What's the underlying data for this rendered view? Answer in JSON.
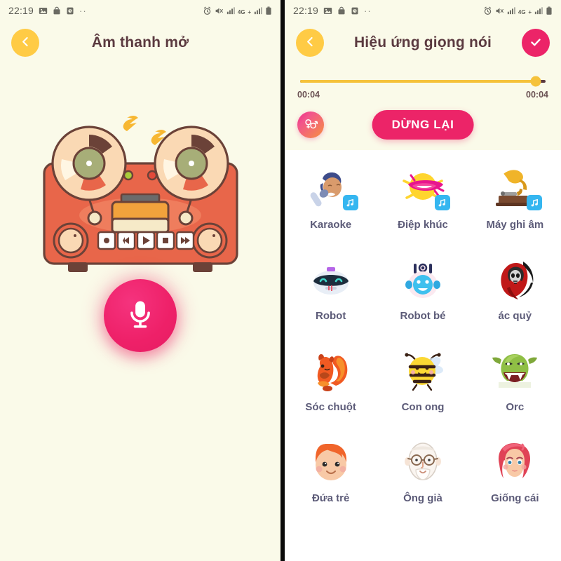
{
  "status_bar": {
    "time": "22:19",
    "left_icons": [
      "gallery-icon",
      "bag-icon",
      "clock-app-icon"
    ],
    "overflow_dots": "··",
    "right_icons": [
      "alarm-icon",
      "mute-icon",
      "signal-bars-icon",
      "network-4gplus-icon",
      "signal-bars-icon",
      "battery-icon"
    ],
    "network_label": "4G",
    "network_sub": "+"
  },
  "left_screen": {
    "header": {
      "title": "Âm thanh mở",
      "back_icon": "chevron-left-icon"
    },
    "illustration": {
      "name": "reel-to-reel-tape-recorder",
      "music_notes": 3,
      "led_green": "#A9CC3B",
      "led_red": "#E34A3A",
      "body_color": "#E8664A",
      "transport_buttons": [
        "record",
        "rewind",
        "play",
        "stop",
        "fast-forward"
      ]
    },
    "record_button": {
      "icon": "microphone-icon",
      "color": "#EC2468"
    }
  },
  "right_screen": {
    "header": {
      "title": "Hiệu ứng giọng nói",
      "back_icon": "chevron-left-icon",
      "confirm_icon": "check-icon"
    },
    "player": {
      "current_time": "00:04",
      "total_time": "00:04",
      "progress_percent": 96,
      "track_color": "#F5C23B",
      "remaining_color": "#5b3a40"
    },
    "controls": {
      "gender_icon": "gender-symbols-icon",
      "stop_label": "DỪNG LẠI",
      "stop_color": "#EC2468"
    },
    "effects": [
      {
        "label": "Karaoke",
        "icon": "karaoke-singer-icon",
        "badge": "music-note-badge"
      },
      {
        "label": "Điệp khúc",
        "icon": "lips-chorus-icon",
        "badge": "music-note-badge"
      },
      {
        "label": "Máy ghi âm",
        "icon": "gramophone-icon",
        "badge": "music-note-badge"
      },
      {
        "label": "Robot",
        "icon": "robot-face-icon",
        "badge": ""
      },
      {
        "label": "Robot bé",
        "icon": "baby-robot-icon",
        "badge": ""
      },
      {
        "label": "ác quỷ",
        "icon": "grim-reaper-icon",
        "badge": ""
      },
      {
        "label": "Sóc chuột",
        "icon": "squirrel-icon",
        "badge": ""
      },
      {
        "label": "Con ong",
        "icon": "bee-icon",
        "badge": ""
      },
      {
        "label": "Orc",
        "icon": "orc-icon",
        "badge": ""
      },
      {
        "label": "Đứa trẻ",
        "icon": "child-face-icon",
        "badge": ""
      },
      {
        "label": "Ông già",
        "icon": "old-man-face-icon",
        "badge": ""
      },
      {
        "label": "Giống cái",
        "icon": "female-face-icon",
        "badge": ""
      }
    ]
  },
  "theme": {
    "cream_bg": "#FAFAE9",
    "pink": "#EC2468",
    "yellow": "#FFCB45",
    "label_color": "#5c5b78",
    "title_color": "#5b3a40"
  }
}
